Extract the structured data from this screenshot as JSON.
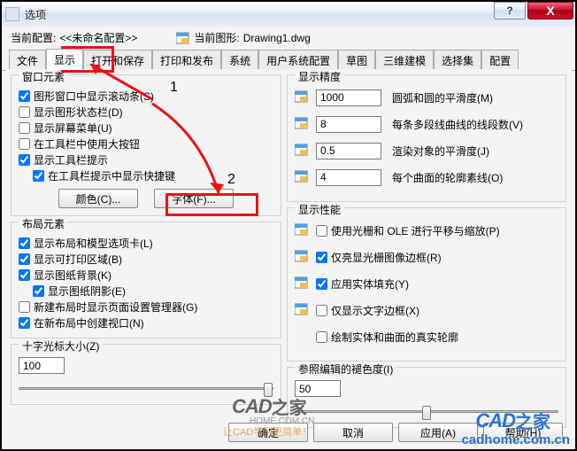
{
  "window": {
    "title": "选项",
    "help": "?",
    "close": "X"
  },
  "header": {
    "current_profile_lbl": "当前配置:",
    "current_profile_val": "<<未命名配置>>",
    "current_drawing_lbl": "当前图形:",
    "current_drawing_val": "Drawing1.dwg"
  },
  "tabs": [
    "文件",
    "显示",
    "打开和保存",
    "打印和发布",
    "系统",
    "用户系统配置",
    "草图",
    "三维建模",
    "选择集",
    "配置"
  ],
  "group_window": {
    "legend": "窗口元素",
    "scrollbars": "图形窗口中显示滚动条(S)",
    "statusbar": "显示图形状态栏(D)",
    "screenmenu": "显示屏幕菜单(U)",
    "largebtn": "在工具栏中使用大按钮",
    "tooltips": "显示工具栏提示",
    "shortcuts": "在工具栏提示中显示快捷键",
    "btn_color": "颜色(C)...",
    "btn_font": "字体(F)..."
  },
  "group_layout": {
    "legend": "布局元素",
    "tabs": "显示布局和模型选项卡(L)",
    "printable": "显示可打印区域(B)",
    "paperbg": "显示图纸背景(K)",
    "papershadow": "显示图纸阴影(E)",
    "pagesetup": "新建布局时显示页面设置管理器(G)",
    "viewport": "在新布局中创建视口(N)"
  },
  "group_precision": {
    "legend": "显示精度",
    "r1_val": "1000",
    "r1_desc": "圆弧和圆的平滑度(M)",
    "r2_val": "8",
    "r2_desc": "每条多段线曲线的线段数(V)",
    "r3_val": "0.5",
    "r3_desc": "渲染对象的平滑度(J)",
    "r4_val": "4",
    "r4_desc": "每个曲面的轮廓素线(O)"
  },
  "group_perf": {
    "legend": "显示性能",
    "r1": "使用光栅和 OLE 进行平移与缩放(P)",
    "r2": "仅亮显光栅图像边框(R)",
    "r3": "应用实体填充(Y)",
    "r4": "仅显示文字边框(X)",
    "r5": "绘制实体和曲面的真实轮廓"
  },
  "group_cross": {
    "legend": "十字光标大小(Z)",
    "val": "100"
  },
  "group_fade": {
    "legend": "参照编辑的褪色度(I)",
    "val": "50"
  },
  "dlg": {
    "ok": "确定",
    "cancel": "取消",
    "apply": "应用(A)",
    "help": "帮助(H)"
  },
  "ann": {
    "n1": "1",
    "n2": "2"
  },
  "wm": {
    "t1": "CAD之家",
    "u1": "cadhome.com.cn",
    "t2": "CAD",
    "t3": "之家",
    "u2": "HOME.COM.CN",
    "slogan": "让CAD学习更简单！"
  }
}
